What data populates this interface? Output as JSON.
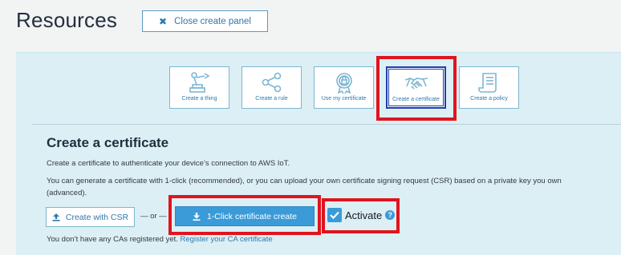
{
  "header": {
    "title": "Resources",
    "close_button": "Close create panel"
  },
  "tiles": [
    {
      "label": "Create a thing",
      "icon": "robot-arm-icon"
    },
    {
      "label": "Create a rule",
      "icon": "share-nodes-icon"
    },
    {
      "label": "Use my certificate",
      "icon": "certificate-badge-icon"
    },
    {
      "label": "Create a certificate",
      "icon": "handshake-icon",
      "selected": true
    },
    {
      "label": "Create a policy",
      "icon": "policy-document-icon"
    }
  ],
  "section": {
    "title": "Create a certificate",
    "desc1": "Create a certificate to authenticate your device’s connection to AWS IoT.",
    "desc2_line1": "You can generate a certificate with 1-click (recommended), or you can upload your own certificate signing request (CSR) based on a private key you own",
    "desc2_line2": "(advanced).",
    "csr_button": "Create with CSR",
    "or_text": "— or —",
    "primary_button": "1-Click certificate create",
    "activate_label": "Activate",
    "activate_checked": true,
    "ca_text": "You don’t have any CAs registered yet.",
    "ca_link": "Register your CA certificate"
  },
  "colors": {
    "accent": "#3a9bd8",
    "link": "#2e79ab",
    "highlight": "#e0141e",
    "panel": "#dceff5"
  }
}
